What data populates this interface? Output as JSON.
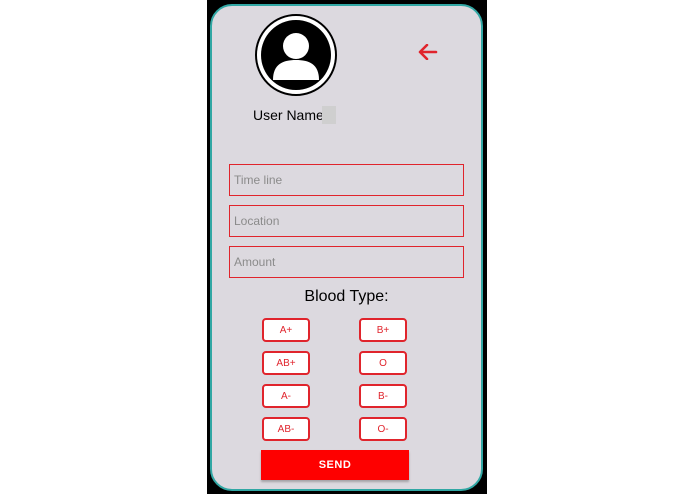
{
  "profile": {
    "username": "User Name",
    "avatar_icon": "user-silhouette-icon"
  },
  "nav": {
    "back_icon": "arrow-left-icon",
    "accent_color": "#e0242c"
  },
  "form": {
    "timeline_placeholder": "Time line",
    "location_placeholder": "Location",
    "amount_placeholder": "Amount",
    "blood_type_label": "Blood Type:",
    "blood_types": {
      "a_pos": "A+",
      "b_pos": "B+",
      "ab_pos": "AB+",
      "o_pos": "O",
      "a_neg": "A-",
      "b_neg": "B-",
      "ab_neg": "AB-",
      "o_neg": "O-"
    },
    "send_label": "SEND",
    "send_color": "#fe0000"
  }
}
